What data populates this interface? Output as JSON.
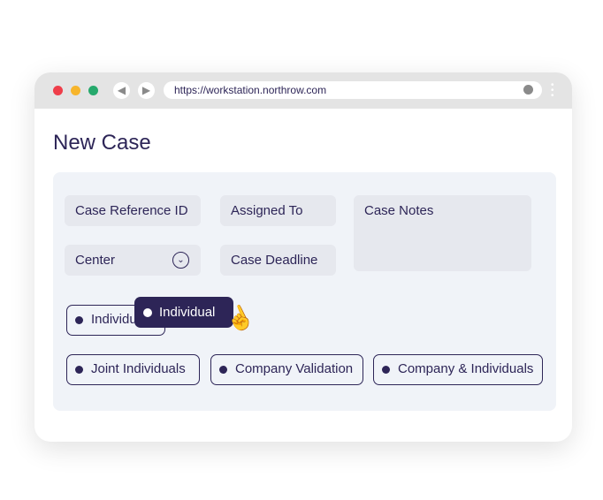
{
  "browser": {
    "url": "https://workstation.northrow.com",
    "controls": {
      "close": "#ef3e4a",
      "minimize": "#f7b52c",
      "maximize": "#26a96c"
    }
  },
  "page": {
    "title": "New Case"
  },
  "form": {
    "case_reference": "Case Reference ID",
    "assigned_to": "Assigned To",
    "case_notes": "Case Notes",
    "center": "Center",
    "case_deadline": "Case Deadline"
  },
  "case_types": [
    "Individual",
    "Joint Individuals",
    "Company Validation",
    "Company & Individuals"
  ],
  "dragging": {
    "label": "Individual",
    "cursor": "hand-pointer-icon"
  },
  "colors": {
    "accent": "#2d2557",
    "panel": "#f0f3f8"
  }
}
